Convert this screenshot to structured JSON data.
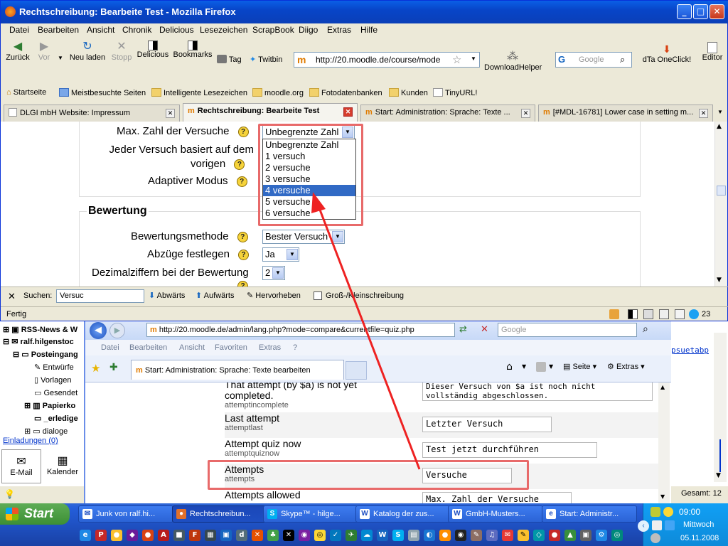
{
  "firefox": {
    "title": "Rechtschreibung: Bearbeite Test - Mozilla Firefox",
    "window_buttons": {
      "minimize": "_",
      "maximize": "□",
      "close": "✕"
    },
    "menu": [
      "Datei",
      "Bearbeiten",
      "Ansicht",
      "Chronik",
      "Delicious",
      "Lesezeichen",
      "ScrapBook",
      "Diigo",
      "Extras",
      "Hilfe"
    ],
    "nav": {
      "back": "Zurück",
      "forward": "Vor",
      "reload": "Neu laden",
      "stop": "Stopp",
      "delicious": "Delicious",
      "bookmarks": "Bookmarks",
      "tag": "Tag",
      "twitbin": "Twitbin",
      "url": "http://20.moodle.de/course/mode",
      "downloadhelper": "DownloadHelper",
      "search_placeholder": "Google",
      "dta": "dTa OneClick!",
      "editor": "Editor"
    },
    "bookmarks": [
      "Startseite",
      "Meistbesuchte Seiten",
      "Intelligente Lesezeichen",
      "moodle.org",
      "Fotodatenbanken",
      "Kunden",
      "TinyURL!"
    ],
    "tabs": [
      {
        "label": "DLGI mbH Website: Impressum",
        "active": false
      },
      {
        "label": "Rechtschreibung: Bearbeite Test",
        "active": true
      },
      {
        "label": "Start: Administration: Sprache: Texte ...",
        "active": false
      },
      {
        "label": "[#MDL-16781] Lower case in setting m...",
        "active": false
      }
    ],
    "form": {
      "max_attempts_label": "Max. Zahl der Versuche",
      "max_attempts_value": "Unbegrenzte Zahl",
      "each_attempt_label_1": "Jeder Versuch basiert auf dem",
      "each_attempt_label_2": "vorigen",
      "adaptive_label": "Adaptiver Modus",
      "dropdown_options": [
        "Unbegrenzte Zahl",
        "1 versuch",
        "2 versuche",
        "3 versuche",
        "4 versuche",
        "5 versuche",
        "6 versuche"
      ],
      "dropdown_selected": "4 versuche",
      "grading_legend": "Bewertung",
      "grading_method_label": "Bewertungsmethode",
      "grading_method_value": "Bester Versuch",
      "penalties_label": "Abzüge festlegen",
      "penalties_value": "Ja",
      "decimals_label": "Dezimalziffern bei der Bewertung",
      "decimals_value": "2"
    },
    "find": {
      "label": "Suchen:",
      "value": "Versuc",
      "down": "Abwärts",
      "up": "Aufwärts",
      "highlight": "Hervorheben",
      "matchcase": "Groß-/Kleinschreibung"
    },
    "status": "Fertig",
    "status_count": "23"
  },
  "outlook": {
    "tree": [
      "RSS-News & W",
      "ralf.hilgenstoc",
      "Posteingang",
      "Entwürfe",
      "Vorlagen",
      "Gesendet",
      "Papierko",
      "_erledige",
      "dialoge"
    ],
    "invitations": "Einladungen (0)",
    "email": "E-Mail",
    "calendar": "Kalender",
    "total": "Gesamt: 12",
    "right_text": "psuetabp"
  },
  "ie": {
    "url": "http://20.moodle.de/admin/lang.php?mode=compare&currentfile=quiz.php",
    "search_placeholder": "Google",
    "menu": [
      "Datei",
      "Bearbeiten",
      "Ansicht",
      "Favoriten",
      "Extras",
      "?"
    ],
    "tab": "Start: Administration: Sprache: Texte bearbeiten",
    "toolbar": {
      "page": "Seite",
      "tools": "Extras"
    },
    "rows": [
      {
        "en": "That attempt (by $a) is not yet completed.",
        "key": "attemptincomplete",
        "de": "Dieser Versuch von $a ist noch nicht vollständig abgeschlossen."
      },
      {
        "en": "Last attempt",
        "key": "attemptlast",
        "de": "Letzter Versuch"
      },
      {
        "en": "Attempt quiz now",
        "key": "attemptquiznow",
        "de": "Test jetzt durchführen"
      },
      {
        "en": "Attempts",
        "key": "attempts",
        "de": "Versuche"
      },
      {
        "en": "Attempts allowed",
        "key": "",
        "de": "Max. Zahl der Versuche"
      }
    ]
  },
  "taskbar": {
    "start": "Start",
    "tasks": [
      "Junk von ralf.hi...",
      "Rechtschreibun...",
      "Skype™ - hilge...",
      "Katalog der zus...",
      "GmbH-Musters...",
      "Start: Administr..."
    ],
    "active_task": 1,
    "time": "09:00",
    "day": "Mittwoch",
    "date": "05.11.2008"
  }
}
